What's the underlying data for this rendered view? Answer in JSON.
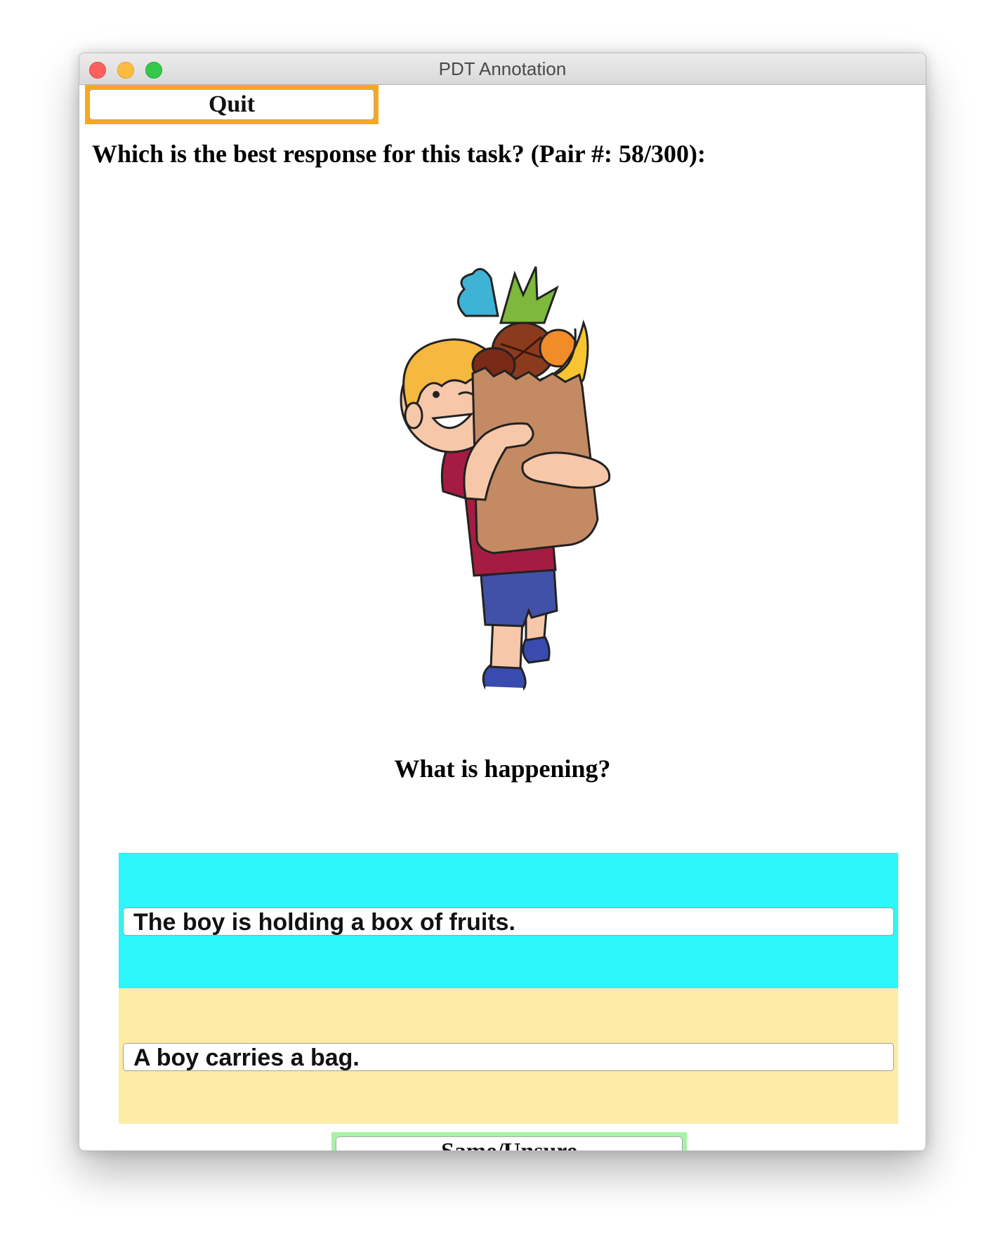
{
  "window": {
    "title": "PDT Annotation"
  },
  "toolbar": {
    "quit_label": "Quit"
  },
  "question": {
    "text": "Which is the best response for this task? (Pair #: 58/300):"
  },
  "task": {
    "prompt": "What is happening?",
    "options": [
      {
        "label": "The boy is holding a box of fruits.",
        "color": "#2cf6f7"
      },
      {
        "label": "A boy carries a bag.",
        "color": "#fdeca6"
      }
    ],
    "same_unsure_label": "Same/Unsure"
  },
  "colors": {
    "quit_accent": "#f7a823",
    "same_unsure_accent": "#a6f2a6"
  }
}
